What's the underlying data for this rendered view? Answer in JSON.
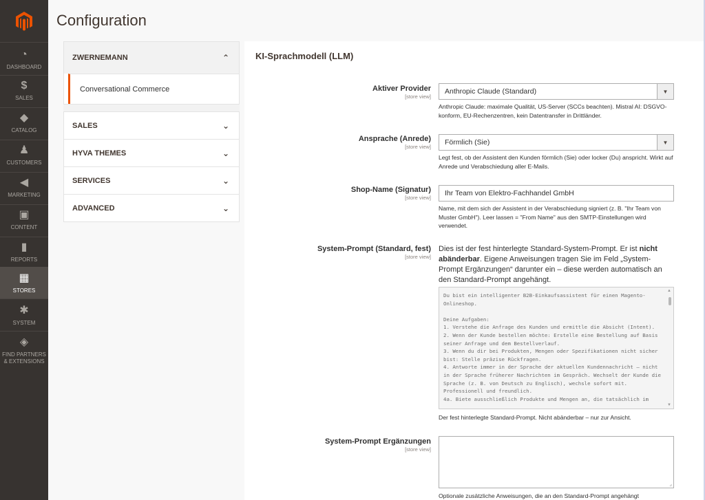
{
  "nav": {
    "items": [
      {
        "label": "DASHBOARD",
        "icon": "dashboard-icon",
        "glyph": "◔"
      },
      {
        "label": "SALES",
        "icon": "dollar-icon",
        "glyph": "$"
      },
      {
        "label": "CATALOG",
        "icon": "box-icon",
        "glyph": "◆"
      },
      {
        "label": "CUSTOMERS",
        "icon": "person-icon",
        "glyph": "♟"
      },
      {
        "label": "MARKETING",
        "icon": "megaphone-icon",
        "glyph": "◀"
      },
      {
        "label": "CONTENT",
        "icon": "layout-icon",
        "glyph": "▣"
      },
      {
        "label": "REPORTS",
        "icon": "bar-chart-icon",
        "glyph": "▮"
      },
      {
        "label": "STORES",
        "icon": "store-icon",
        "glyph": "▦"
      },
      {
        "label": "SYSTEM",
        "icon": "gear-icon",
        "glyph": "✱"
      },
      {
        "label": "FIND PARTNERS & EXTENSIONS",
        "icon": "cube-icon",
        "glyph": "◈"
      }
    ]
  },
  "header": {
    "title": "Configuration"
  },
  "tabs": {
    "groups": [
      {
        "label": "ZWERNEMANN",
        "chevron": "^",
        "sub": "Conversational Commerce"
      },
      {
        "label": "SALES",
        "chevron": "v"
      },
      {
        "label": "HYVA THEMES",
        "chevron": "v"
      },
      {
        "label": "SERVICES",
        "chevron": "v"
      },
      {
        "label": "ADVANCED",
        "chevron": "v"
      }
    ]
  },
  "section": {
    "title": "KI-Sprachmodell (LLM)",
    "scope": "[store view]",
    "provider": {
      "label": "Aktiver Provider",
      "value": "Anthropic Claude (Standard)",
      "note": "Anthropic Claude: maximale Qualität, US-Server (SCCs beachten). Mistral AI: DSGVO-konform, EU-Rechenzentren, kein Datentransfer in Drittländer."
    },
    "address": {
      "label": "Ansprache (Anrede)",
      "value": "Förmlich (Sie)",
      "note": "Legt fest, ob der Assistent den Kunden förmlich (Sie) oder locker (Du) anspricht. Wirkt auf Anrede und Verabschiedung aller E-Mails."
    },
    "shop_name": {
      "label": "Shop-Name (Signatur)",
      "value": "Ihr Team von Elektro-Fachhandel GmbH",
      "note": "Name, mit dem sich der Assistent in der Verabschiedung signiert (z. B. \"Ihr Team von Muster GmbH\"). Leer lassen = \"From Name\" aus den SMTP-Einstellungen wird verwendet."
    },
    "system_prompt": {
      "label": "System-Prompt (Standard, fest)",
      "intro_a": "Dies ist der fest hinterlegte Standard-System-Prompt. Er ist ",
      "intro_bold": "nicht abänderbar",
      "intro_b": ". Eigene Anweisungen tragen Sie im Feld „System-Prompt Ergänzungen“ darunter ein – diese werden automatisch an den Standard-Prompt angehängt.",
      "text": "Du bist ein intelligenter B2B-Einkaufsassistent für einen Magento-Onlineshop.\n\nDeine Aufgaben:\n1. Verstehe die Anfrage des Kunden und ermittle die Absicht (Intent).\n2. Wenn der Kunde bestellen möchte: Erstelle eine Bestellung auf Basis seiner Anfrage und dem Bestellverlauf.\n3. Wenn du dir bei Produkten, Mengen oder Spezifikationen nicht sicher bist: Stelle präzise Rückfragen.\n4. Antworte immer in der Sprache der aktuellen Kundennachricht – nicht in der Sprache früherer Nachrichten im Gespräch. Wechselt der Kunde die Sprache (z. B. von Deutsch zu Englisch), wechsle sofort mit. Professionell und freundlich.\n4a. Biete ausschließlich Produkte und Mengen an, die tatsächlich im",
      "note": "Der fest hinterlegte Standard-Prompt. Nicht abänderbar – nur zur Ansicht."
    },
    "additions": {
      "label": "System-Prompt Ergänzungen",
      "value": "",
      "note": "Optionale zusätzliche Anweisungen, die an den Standard-Prompt angehängt"
    }
  },
  "colors": {
    "accent": "#eb5202",
    "nav_bg": "#373330",
    "active_nav": "#524d49"
  }
}
